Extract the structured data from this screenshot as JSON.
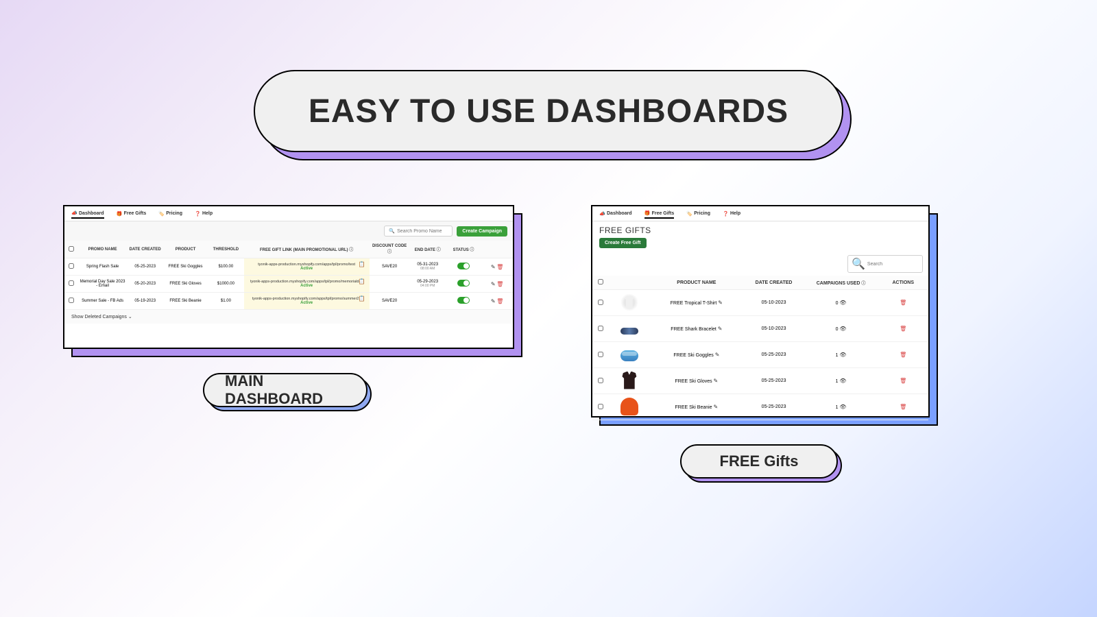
{
  "title": "EASY TO USE DASHBOARDS",
  "label1": "MAIN DASHBOARD",
  "label2": "FREE Gifts",
  "nav": {
    "dashboard": "Dashboard",
    "free_gifts": "Free Gifts",
    "pricing": "Pricing",
    "help": "Help"
  },
  "panel1": {
    "search_placeholder": "Search Promo Name",
    "create_btn": "Create Campaign",
    "headers": {
      "promo_name": "PROMO NAME",
      "date_created": "DATE CREATED",
      "product": "PRODUCT",
      "threshold": "THRESHOLD",
      "gift_link": "FREE GIFT LINK (MAIN PROMOTIONAL URL)",
      "discount_code": "DISCOUNT CODE",
      "end_date": "END DATE",
      "status": "STATUS"
    },
    "rows": [
      {
        "name": "Spring Flash Sale",
        "date": "05-25-2023",
        "product": "FREE Ski Goggles",
        "threshold": "$100.00",
        "url": "tyonik-apps-production.myshopify.com/apps/tpl/promo/test",
        "active": "Active",
        "code": "SAVE20",
        "end": "05-31-2023",
        "end_time": "08:00 AM"
      },
      {
        "name": "Memorial Day Sale 2023 - Email",
        "date": "05-20-2023",
        "product": "FREE Ski Gloves",
        "threshold": "$1000.00",
        "url": "tyonik-apps-production.myshopify.com/apps/tpl/promo/memorialday",
        "active": "Active",
        "code": "",
        "end": "05-29-2023",
        "end_time": "04:00 PM"
      },
      {
        "name": "Summer Sale - FB Ads",
        "date": "05-19-2023",
        "product": "FREE Ski Beanie",
        "threshold": "$1.00",
        "url": "tyonik-apps-production.myshopify.com/apps/tpl/promo/summer23",
        "active": "Active",
        "code": "SAVE20",
        "end": "",
        "end_time": ""
      }
    ],
    "show_deleted": "Show Deleted Campaigns"
  },
  "panel2": {
    "title": "FREE GIFTS",
    "create_btn": "Create Free Gift",
    "search_placeholder": "Search",
    "headers": {
      "product_name": "PRODUCT NAME",
      "date_created": "DATE CREATED",
      "campaigns_used": "CAMPAIGNS USED",
      "actions": "ACTIONS"
    },
    "rows": [
      {
        "name": "FREE Tropical T-Shirt",
        "date": "05-10-2023",
        "used": "0",
        "thumb": "tshirt"
      },
      {
        "name": "FREE Shark Bracelet",
        "date": "05-10-2023",
        "used": "0",
        "thumb": "bracelet"
      },
      {
        "name": "FREE Ski Goggles",
        "date": "05-25-2023",
        "used": "1",
        "thumb": "goggles"
      },
      {
        "name": "FREE Ski Gloves",
        "date": "05-25-2023",
        "used": "1",
        "thumb": "gloves"
      },
      {
        "name": "FREE Ski Beanie",
        "date": "05-25-2023",
        "used": "1",
        "thumb": "beanie"
      }
    ]
  }
}
